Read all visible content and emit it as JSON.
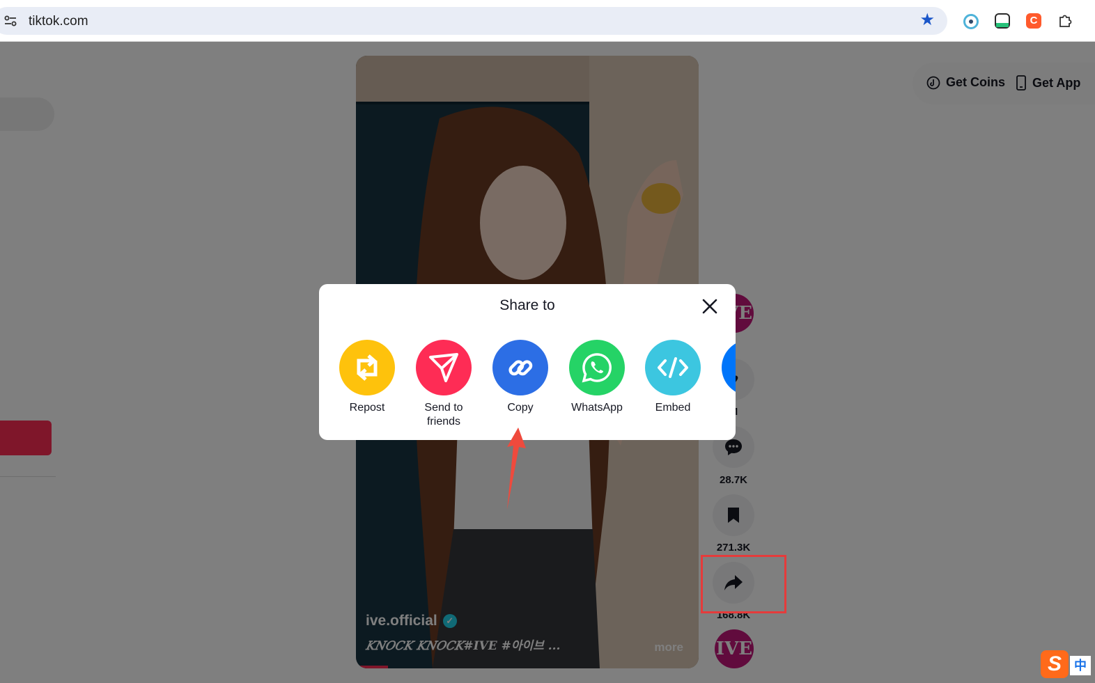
{
  "browser": {
    "url": "tiktok.com",
    "extensions": [
      "eye-extension-icon",
      "robot-extension-icon",
      "c-extension-icon",
      "puzzle-extensions-icon"
    ],
    "ext3_letter": "C"
  },
  "topbar": {
    "get_coins": "Get Coins",
    "get_app": "Get App"
  },
  "video": {
    "author": "ive.official",
    "caption": "𝐾𝑁𝑂𝐶𝐾 𝐾𝑁𝑂𝐶𝐾#IVE #아이브 ...",
    "more": "more"
  },
  "rail": {
    "avatar_text": "IVE",
    "likes": "M",
    "comments": "28.7K",
    "saves": "271.3K",
    "shares": "168.8K"
  },
  "share_modal": {
    "title": "Share to",
    "options": [
      {
        "label": "Repost",
        "color": "#fec20c",
        "icon": "repost-icon"
      },
      {
        "label": "Send to friends",
        "color": "#fe2c55",
        "icon": "send-icon"
      },
      {
        "label": "Copy",
        "color": "#2c6ee5",
        "icon": "link-icon"
      },
      {
        "label": "WhatsApp",
        "color": "#25d366",
        "icon": "whatsapp-icon"
      },
      {
        "label": "Embed",
        "color": "#3cc6e0",
        "icon": "embed-icon"
      },
      {
        "label": "Fa",
        "color": "#0075fa",
        "icon": "facebook-icon"
      }
    ]
  },
  "ime": {
    "logo": "S",
    "mode": "中"
  }
}
